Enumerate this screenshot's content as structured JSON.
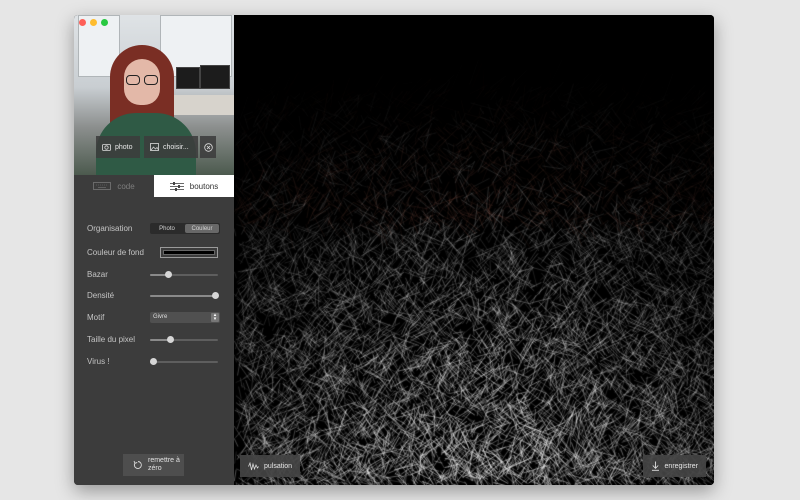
{
  "camera": {
    "photo_label": "photo",
    "choose_label": "choisir..."
  },
  "tabs": [
    {
      "label": "code",
      "active": false
    },
    {
      "label": "boutons",
      "active": true
    }
  ],
  "controls": {
    "organisation": {
      "label": "Organisation",
      "options": [
        "Photo",
        "Couleur"
      ],
      "selected": "Couleur"
    },
    "background_color": {
      "label": "Couleur de fond",
      "value": "#000000"
    },
    "bazar": {
      "label": "Bazar",
      "value": 0.27
    },
    "densite": {
      "label": "Densité",
      "value": 0.96
    },
    "motif": {
      "label": "Motif",
      "value": "Givre"
    },
    "pixel_size": {
      "label": "Taille du pixel",
      "value": 0.3
    },
    "virus": {
      "label": "Virus !",
      "value": 0.05
    }
  },
  "reset": {
    "label": "remettre à zéro"
  },
  "canvas": {
    "pulse_label": "pulsation",
    "save_label": "enregistrer"
  },
  "colors": {
    "sidebar_bg": "#3c3c3c",
    "canvas_bg": "#000000",
    "stroke_light": "#ffffff",
    "stroke_warm": "#b8705c"
  }
}
